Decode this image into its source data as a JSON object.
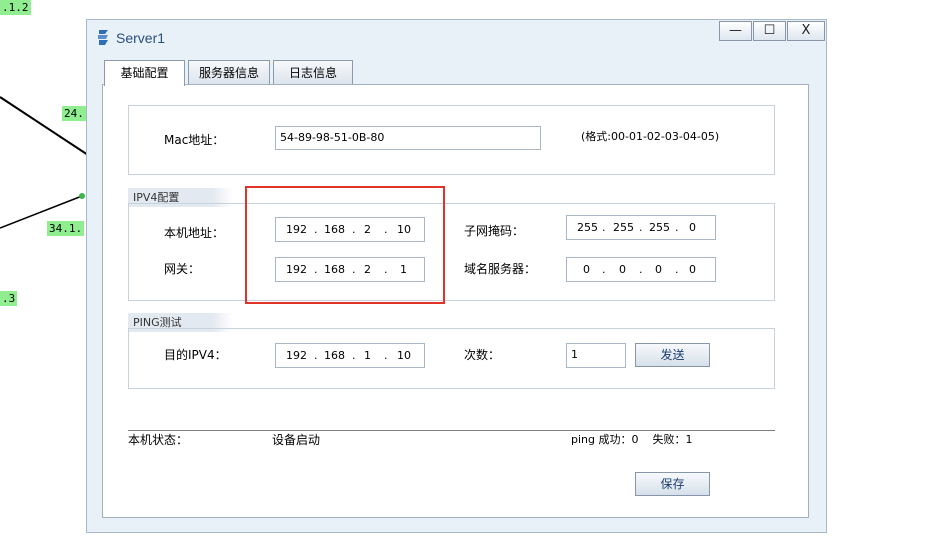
{
  "topology": {
    "labels": [
      ".1.2",
      "24.",
      "34.1.",
      ".3"
    ]
  },
  "window": {
    "title": "Server1",
    "controls": {
      "minimize": "—",
      "maximize": "☐",
      "close": "X"
    }
  },
  "tabs": [
    {
      "label": "基础配置",
      "active": true
    },
    {
      "label": "服务器信息",
      "active": false
    },
    {
      "label": "日志信息",
      "active": false
    }
  ],
  "mac": {
    "label": "Mac地址：",
    "value": "54-89-98-51-0B-80",
    "format_hint": "(格式:00-01-02-03-04-05)"
  },
  "ipv4": {
    "legend": "IPV4配置",
    "local_ip_label": "本机地址：",
    "local_ip": [
      "192",
      "168",
      "2",
      "10"
    ],
    "gateway_label": "网关：",
    "gateway": [
      "192",
      "168",
      "2",
      "1"
    ],
    "mask_label": "子网掩码：",
    "mask": [
      "255",
      "255",
      "255",
      "0"
    ],
    "dns_label": "域名服务器：",
    "dns": [
      "0",
      "0",
      "0",
      "0"
    ]
  },
  "ping": {
    "legend": "PING测试",
    "dest_label": "目的IPV4：",
    "dest": [
      "192",
      "168",
      "1",
      "10"
    ],
    "count_label": "次数：",
    "count": "1",
    "send_button": "发送"
  },
  "status": {
    "label": "本机状态：",
    "value": "设备启动",
    "ping_summary": "ping 成功：0    失败：1"
  },
  "save_button": "保存",
  "colors": {
    "accent_title": "#2b4e7c",
    "highlight_box": "#e0342b",
    "topology_label_bg": "#90ee90"
  }
}
